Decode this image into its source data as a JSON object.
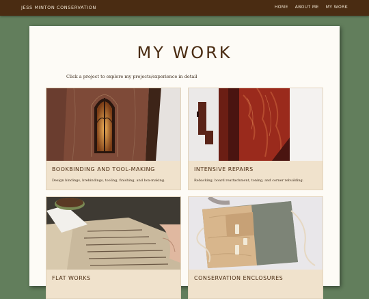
{
  "header": {
    "site_title": "JESS MINTON CONSERVATION",
    "nav": [
      "HOME",
      "ABOUT ME",
      "MY WORK"
    ]
  },
  "main": {
    "title": "MY WORK",
    "intro": "Click a project to explore my projects/experience in detail",
    "projects": [
      {
        "title": "BOOKBINDING AND TOOL-MAKING",
        "description": "Design bindings, brebindings, tooling, finishing, and box-making."
      },
      {
        "title": "INTENSIVE REPAIRS",
        "description": "Rebacking, board reattachment, toning, and corner rebuilding."
      },
      {
        "title": "FLAT WORKS",
        "description": ""
      },
      {
        "title": "CONSERVATION ENCLOSURES",
        "description": ""
      }
    ]
  },
  "colors": {
    "background": "#627e5c",
    "header": "#4a2c12",
    "panel": "#fdfbf6",
    "card": "#f0e2cc",
    "accent_text": "#4a2c12"
  }
}
